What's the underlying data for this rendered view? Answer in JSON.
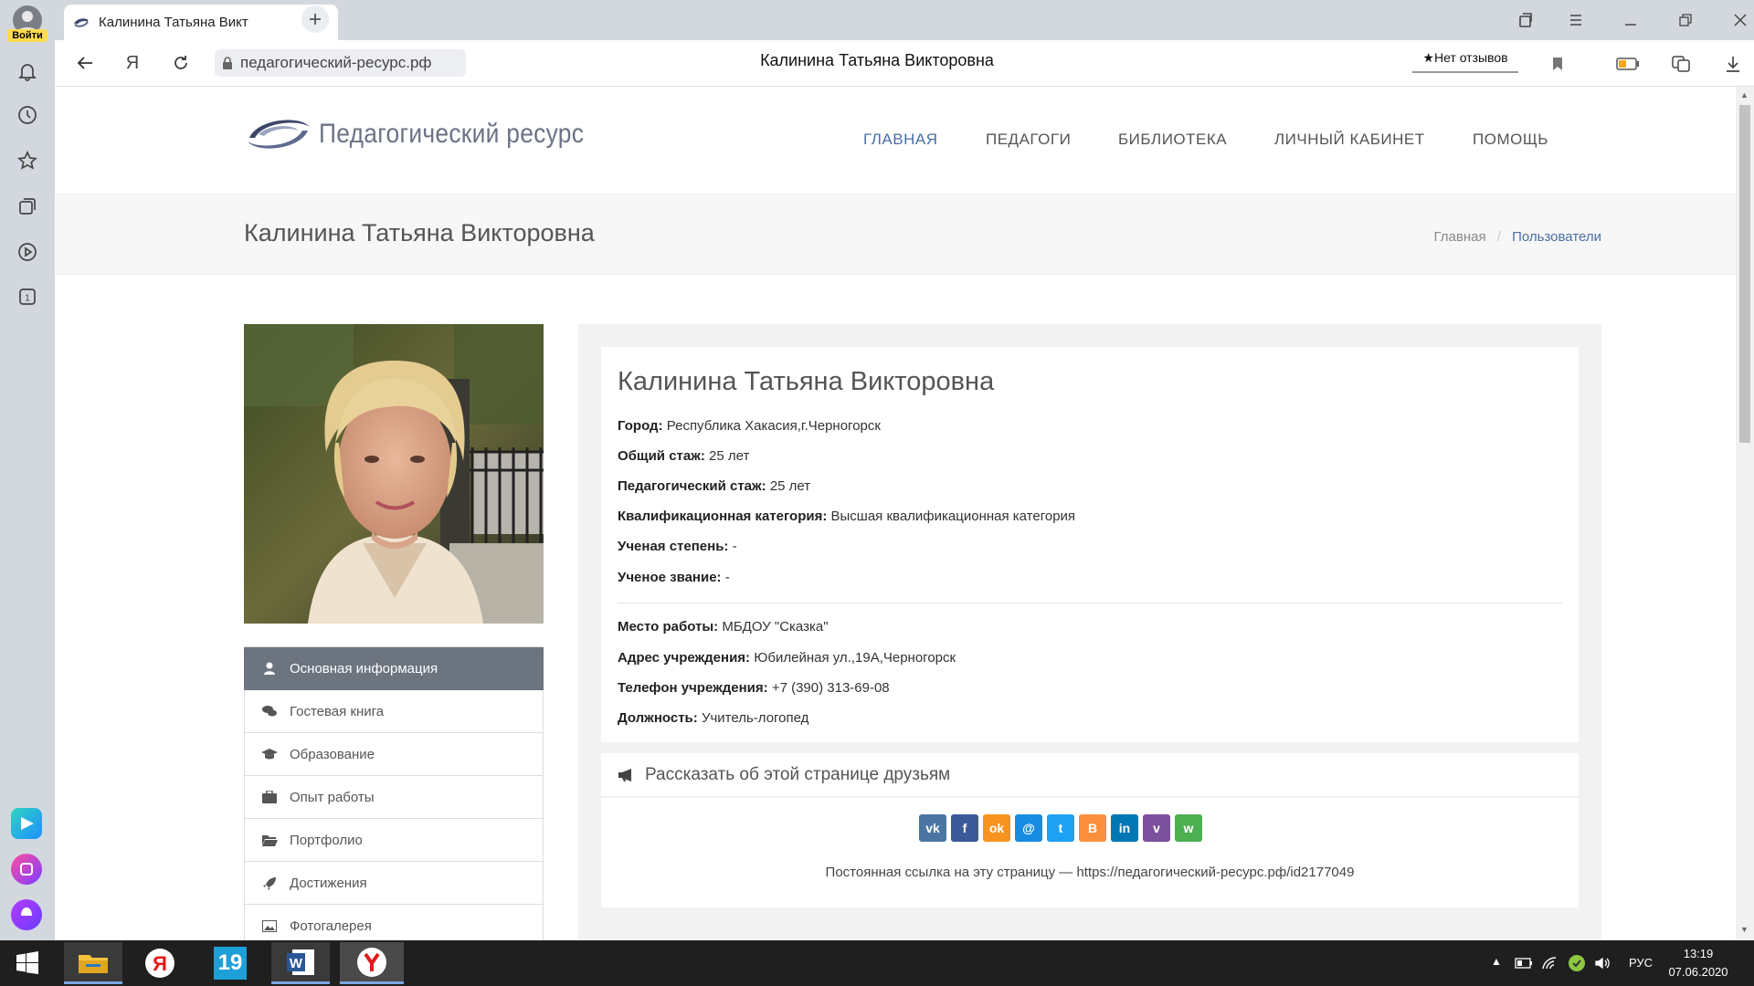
{
  "browser": {
    "login_label": "Войти",
    "tab_title": "Калинина Татьяна Викт",
    "url": "педагогический-ресурс.рф",
    "page_title": "Калинина Татьяна Викторовна",
    "reviews_label": "Нет отзывов"
  },
  "site": {
    "logo_text": "Педагогический ресурс",
    "nav": [
      "ГЛАВНАЯ",
      "ПЕДАГОГИ",
      "БИБЛИОТЕКА",
      "ЛИЧНЫЙ КАБИНЕТ",
      "ПОМОЩЬ"
    ],
    "accent_color": "#4a6fa5"
  },
  "header": {
    "title": "Калинина Татьяна Викторовна",
    "breadcrumb": {
      "home": "Главная",
      "separator": "/",
      "current": "Пользователи"
    }
  },
  "sidebar": {
    "items": [
      {
        "label": "Основная информация",
        "icon": "user-icon",
        "active": true
      },
      {
        "label": "Гостевая книга",
        "icon": "comments-icon"
      },
      {
        "label": "Образование",
        "icon": "graduation-cap-icon"
      },
      {
        "label": "Опыт работы",
        "icon": "briefcase-icon"
      },
      {
        "label": "Портфолио",
        "icon": "folder-open-icon"
      },
      {
        "label": "Достижения",
        "icon": "rocket-icon"
      },
      {
        "label": "Фотогалерея",
        "icon": "picture-icon"
      }
    ]
  },
  "profile": {
    "name": "Калинина Татьяна Викторовна",
    "fields": [
      {
        "label": "Город:",
        "value": "Республика Хакасия,г.Черногорск"
      },
      {
        "label": "Общий стаж:",
        "value": "25 лет"
      },
      {
        "label": "Педагогический стаж:",
        "value": "25 лет"
      },
      {
        "label": "Квалификационная категория:",
        "value": "Высшая квалификационная категория"
      },
      {
        "label": "Ученая степень:",
        "value": "-"
      },
      {
        "label": "Ученое звание:",
        "value": "-"
      }
    ],
    "work_fields": [
      {
        "label": "Место работы:",
        "value": "МБДОУ \"Сказка\""
      },
      {
        "label": "Адрес учреждения:",
        "value": "Юбилейная ул.,19А,Черногорск"
      },
      {
        "label": "Телефон учреждения:",
        "value": "+7 (390) 313-69-08"
      },
      {
        "label": "Должность:",
        "value": "Учитель-логопед"
      }
    ]
  },
  "share": {
    "title": "Рассказать об этой странице друзьям",
    "buttons": [
      {
        "name": "vk",
        "glyph": "vk",
        "color": "#4c75a3"
      },
      {
        "name": "facebook",
        "glyph": "f",
        "color": "#3b5998"
      },
      {
        "name": "odnoklassniki",
        "glyph": "ok",
        "color": "#f7931e"
      },
      {
        "name": "moimir",
        "glyph": "@",
        "color": "#168de2"
      },
      {
        "name": "twitter",
        "glyph": "t",
        "color": "#1da1f2"
      },
      {
        "name": "blogger",
        "glyph": "B",
        "color": "#fb8f3d"
      },
      {
        "name": "linkedin",
        "glyph": "in",
        "color": "#0077b5"
      },
      {
        "name": "viber",
        "glyph": "v",
        "color": "#7b519d"
      },
      {
        "name": "whatsapp",
        "glyph": "w",
        "color": "#4caf50"
      }
    ],
    "permalink": "Постоянная ссылка на эту страницу — https://педагогический-ресурс.рф/id2177049"
  },
  "taskbar": {
    "time": "13:19",
    "date": "07.06.2020",
    "lang": "РУС",
    "badge": "19"
  }
}
